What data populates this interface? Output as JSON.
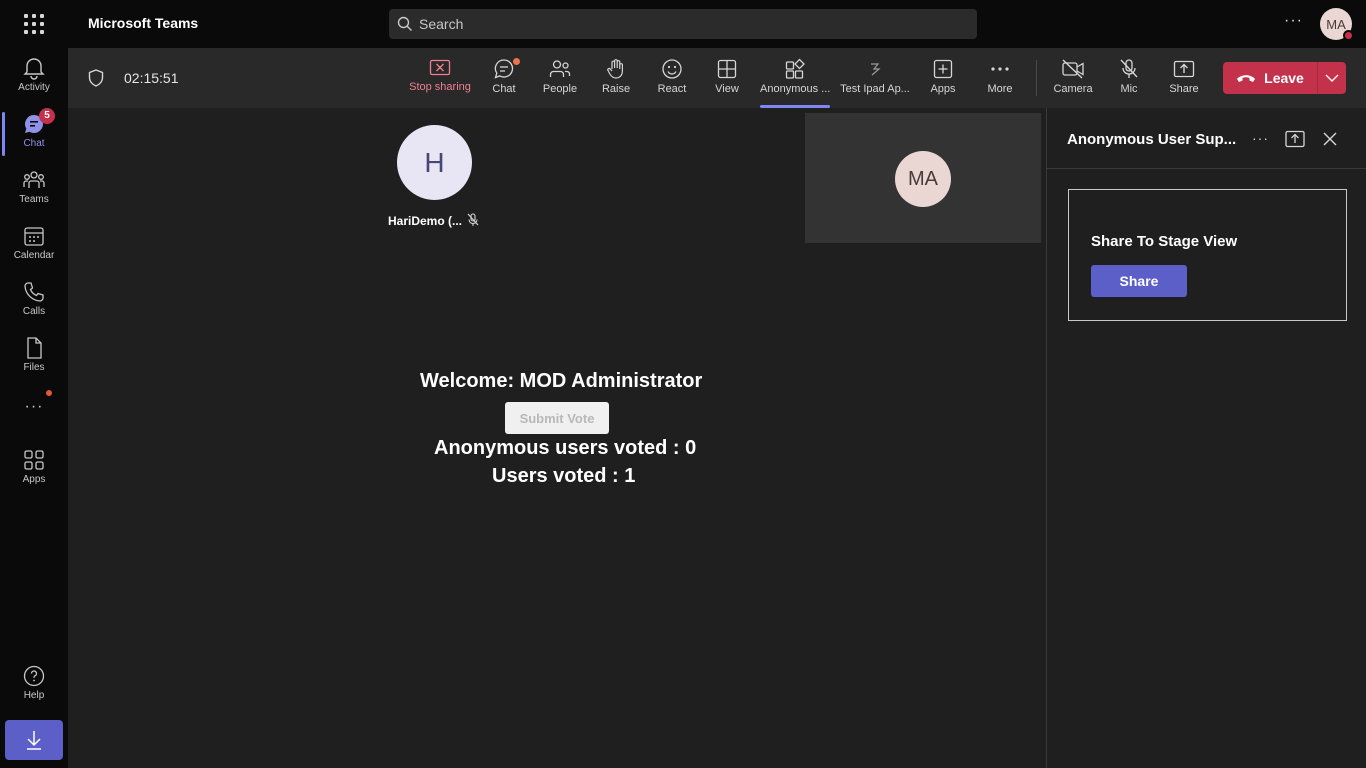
{
  "app": {
    "title": "Microsoft Teams",
    "avatar_initials": "MA"
  },
  "search": {
    "placeholder": "Search"
  },
  "rail": {
    "items": [
      {
        "label": "Activity",
        "icon": "bell-icon"
      },
      {
        "label": "Chat",
        "icon": "chat-icon",
        "badge": "5",
        "active": true
      },
      {
        "label": "Teams",
        "icon": "teams-icon"
      },
      {
        "label": "Calendar",
        "icon": "calendar-icon"
      },
      {
        "label": "Calls",
        "icon": "phone-icon"
      },
      {
        "label": "Files",
        "icon": "file-icon"
      },
      {
        "label": "Apps",
        "icon": "apps-icon"
      },
      {
        "label": "Help",
        "icon": "help-icon"
      }
    ]
  },
  "meeting": {
    "timer": "02:15:51",
    "toolbar": [
      {
        "label": "Stop sharing",
        "icon": "stop-sharing-icon"
      },
      {
        "label": "Chat",
        "icon": "chat-icon"
      },
      {
        "label": "People",
        "icon": "people-icon"
      },
      {
        "label": "Raise",
        "icon": "hand-icon"
      },
      {
        "label": "React",
        "icon": "smiley-icon"
      },
      {
        "label": "View",
        "icon": "grid-view-icon"
      },
      {
        "label": "Anonymous ...",
        "icon": "app-icon",
        "selected": true
      },
      {
        "label": "Test Ipad Ap...",
        "icon": "app-icon"
      },
      {
        "label": "Apps",
        "icon": "add-icon"
      },
      {
        "label": "More",
        "icon": "more-icon"
      },
      {
        "label": "Camera",
        "icon": "camera-off-icon"
      },
      {
        "label": "Mic",
        "icon": "mic-off-icon"
      },
      {
        "label": "Share",
        "icon": "share-icon"
      }
    ],
    "leave_label": "Leave"
  },
  "stage": {
    "participant": {
      "initial": "H",
      "name": "HariDemo (..."
    },
    "self_initials": "MA",
    "welcome": "Welcome: MOD Administrator",
    "submit_vote": "Submit Vote",
    "anonymous_voted": "Anonymous users voted : 0",
    "users_voted": "Users voted : 1"
  },
  "panel": {
    "title": "Anonymous User Sup...",
    "card_title": "Share To Stage View",
    "share_label": "Share"
  },
  "colors": {
    "accent": "#5b5fc7",
    "leave": "#c4314b",
    "stop_sharing": "#f07f91"
  }
}
